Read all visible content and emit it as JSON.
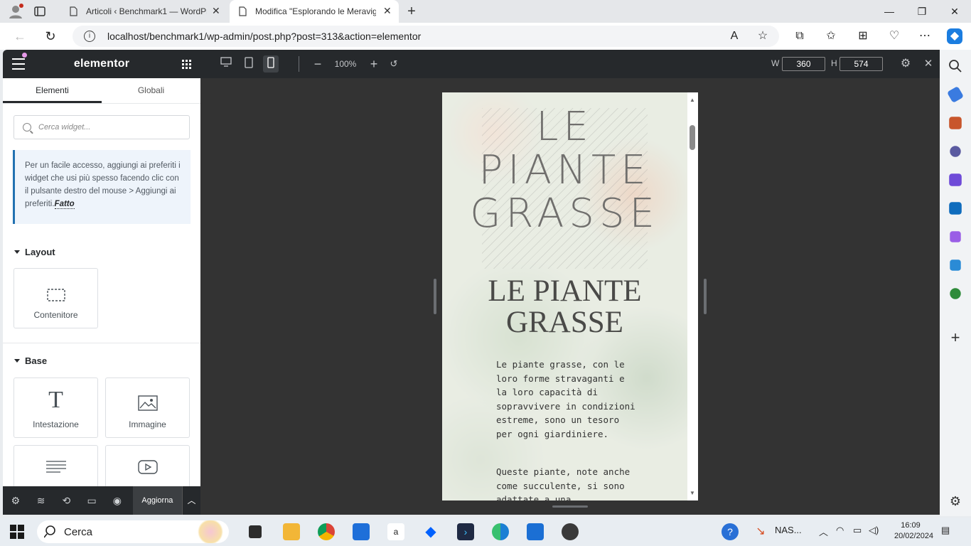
{
  "browser": {
    "tabs": [
      {
        "label": "Articoli ‹ Benchmark1 — WordPr",
        "active": false
      },
      {
        "label": "Modifica \"Esplorando le Meravig",
        "active": true
      }
    ],
    "url": "localhost/benchmark1/wp-admin/post.php?post=313&action=elementor"
  },
  "elementor": {
    "logo": "elementor",
    "tabs": [
      "Elementi",
      "Globali"
    ],
    "search_placeholder": "Cerca widget...",
    "tip_text": "Per un facile accesso, aggiungi ai preferiti i widget che usi più spesso facendo clic con il pulsante destro del mouse > Aggiungi ai preferiti.",
    "tip_done": "Fatto",
    "sections": {
      "layout": "Layout",
      "base": "Base"
    },
    "widgets": {
      "container": "Contenitore",
      "heading": "Intestazione",
      "image": "Immagine"
    },
    "footer_save": "Aggiorna"
  },
  "toolbar": {
    "zoom": "100%",
    "width_label": "W",
    "width_value": "360",
    "height_label": "H",
    "height_value": "574"
  },
  "preview": {
    "title_line1": "LE",
    "title_line2": "PIANTE",
    "title_line3": "GRASSE",
    "heading_line1": "LE PIANTE",
    "heading_line2": "GRASSE",
    "paragraph1": "Le piante grasse, con le loro forme stravaganti e la loro capacità di sopravvivere in condizioni estreme, sono un tesoro per ogni giardiniere.",
    "paragraph2": "Queste piante, note anche come succulente, si sono adattate a una"
  },
  "taskbar": {
    "search": "Cerca",
    "nas": "NAS...",
    "time": "16:09",
    "date": "20/02/2024"
  }
}
